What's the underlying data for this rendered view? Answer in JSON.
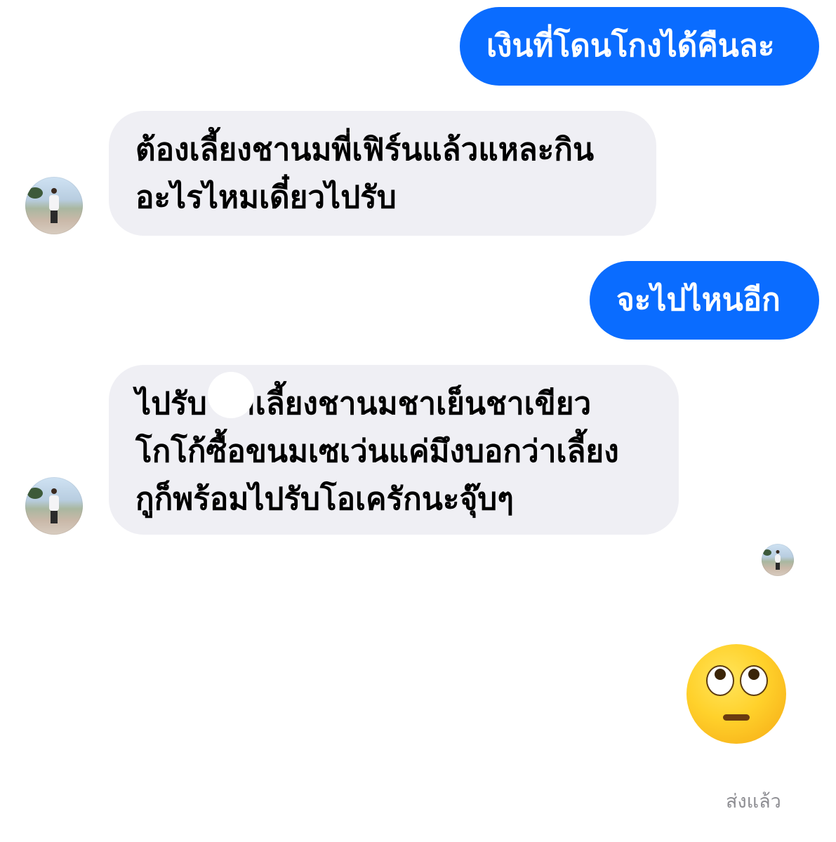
{
  "messages": [
    {
      "direction": "sent",
      "text": "เงินที่โดนโกงได้คืนละ"
    },
    {
      "direction": "received",
      "lines": [
        "ต้องเลี้ยงชานมพี่เฟิร์นแล้วแหละกิน",
        "อะไรไหมเดี๋ยวไปรับ"
      ]
    },
    {
      "direction": "sent",
      "text": "จะไปไหนอีก"
    },
    {
      "direction": "received",
      "lines": [
        "ไปรับ    มาเลี้ยงชานมชาเย็นชาเขียว",
        "โกโก้ซื้อขนมเซเว่นแค่มึงบอกว่าเลี้ยง",
        "กูก็พร้อมไปรับโอเครักนะจุ๊บๆ"
      ]
    },
    {
      "direction": "sent",
      "emoji": "face-with-rolling-eyes"
    }
  ],
  "status": "ส่งแล้ว",
  "colors": {
    "sent_bubble": "#0a6cff",
    "received_bubble": "#efeff4",
    "status_text": "#8e8e93"
  }
}
